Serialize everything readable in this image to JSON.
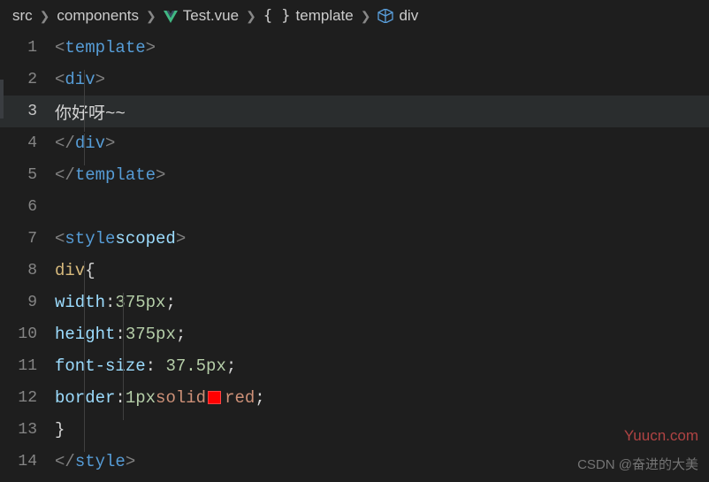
{
  "breadcrumbs": {
    "src": "src",
    "components": "components",
    "file": "Test.vue",
    "template": "template",
    "element": "div"
  },
  "code": {
    "l1": {
      "open": "<",
      "tag": "template",
      "close": ">"
    },
    "l2": {
      "open": "<",
      "tag": "div",
      "close": ">"
    },
    "l3": {
      "text": "你好呀~~"
    },
    "l4": {
      "open": "</",
      "tag": "div",
      "close": ">"
    },
    "l5": {
      "open": "</",
      "tag": "template",
      "close": ">"
    },
    "l7": {
      "open": "<",
      "tag": "style",
      "attr": "scoped",
      "close": ">"
    },
    "l8": {
      "sel": "div",
      "brace": "{"
    },
    "l9": {
      "prop": "width",
      "colon": ":",
      "num": "375",
      "unit": "px",
      "semi": ";"
    },
    "l10": {
      "prop": "height",
      "colon": ":",
      "num": "375",
      "unit": "px",
      "semi": ";"
    },
    "l11": {
      "prop": "font-size",
      "colon": ": ",
      "num": "37.5",
      "unit": "px",
      "semi": ";"
    },
    "l12": {
      "prop": "border",
      "colon": ":",
      "num": "1",
      "unit": "px",
      "val1": "solid",
      "val2": "red",
      "semi": ";"
    },
    "l13": {
      "brace": "}"
    },
    "l14": {
      "open": "</",
      "tag": "style",
      "close": ">"
    }
  },
  "gutter": {
    "n1": "1",
    "n2": "2",
    "n3": "3",
    "n4": "4",
    "n5": "5",
    "n6": "6",
    "n7": "7",
    "n8": "8",
    "n9": "9",
    "n10": "10",
    "n11": "11",
    "n12": "12",
    "n13": "13",
    "n14": "14"
  },
  "watermark": {
    "site": "Yuucn.com",
    "credit": "CSDN @奋进的大美"
  },
  "colors": {
    "swatch": "#ff0000"
  }
}
